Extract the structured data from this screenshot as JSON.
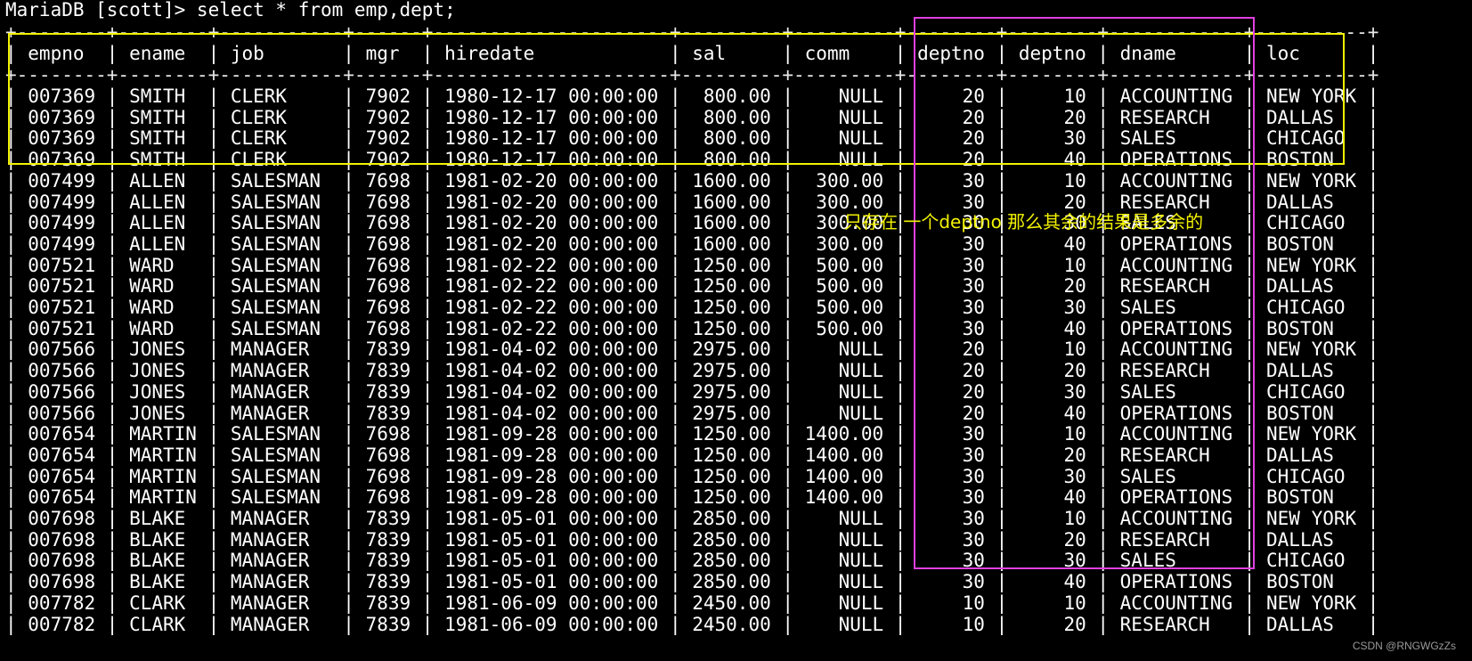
{
  "prompt": "MariaDB [scott]> select * from emp,dept;",
  "table": {
    "border_top": "+--------+--------+-----------+------+---------------------+---------+---------+--------+--------+------------+----------+",
    "header": "| empno  | ename  | job       | mgr  | hiredate            | sal     | comm    | deptno | deptno | dname      | loc      |",
    "separator": "+--------+--------+-----------+------+---------------------+---------+---------+--------+--------+------------+----------+",
    "rows": [
      "| 007369 | SMITH  | CLERK     | 7902 | 1980-12-17 00:00:00 |  800.00 |    NULL |     20 |     10 | ACCOUNTING | NEW YORK |",
      "| 007369 | SMITH  | CLERK     | 7902 | 1980-12-17 00:00:00 |  800.00 |    NULL |     20 |     20 | RESEARCH   | DALLAS   |",
      "| 007369 | SMITH  | CLERK     | 7902 | 1980-12-17 00:00:00 |  800.00 |    NULL |     20 |     30 | SALES      | CHICAGO  |",
      "| 007369 | SMITH  | CLERK     | 7902 | 1980-12-17 00:00:00 |  800.00 |    NULL |     20 |     40 | OPERATIONS | BOSTON   |",
      "| 007499 | ALLEN  | SALESMAN  | 7698 | 1981-02-20 00:00:00 | 1600.00 |  300.00 |     30 |     10 | ACCOUNTING | NEW YORK |",
      "| 007499 | ALLEN  | SALESMAN  | 7698 | 1981-02-20 00:00:00 | 1600.00 |  300.00 |     30 |     20 | RESEARCH   | DALLAS   |",
      "| 007499 | ALLEN  | SALESMAN  | 7698 | 1981-02-20 00:00:00 | 1600.00 |  300.00 |     30 |     30 | SALES      | CHICAGO  |",
      "| 007499 | ALLEN  | SALESMAN  | 7698 | 1981-02-20 00:00:00 | 1600.00 |  300.00 |     30 |     40 | OPERATIONS | BOSTON   |",
      "| 007521 | WARD   | SALESMAN  | 7698 | 1981-02-22 00:00:00 | 1250.00 |  500.00 |     30 |     10 | ACCOUNTING | NEW YORK |",
      "| 007521 | WARD   | SALESMAN  | 7698 | 1981-02-22 00:00:00 | 1250.00 |  500.00 |     30 |     20 | RESEARCH   | DALLAS   |",
      "| 007521 | WARD   | SALESMAN  | 7698 | 1981-02-22 00:00:00 | 1250.00 |  500.00 |     30 |     30 | SALES      | CHICAGO  |",
      "| 007521 | WARD   | SALESMAN  | 7698 | 1981-02-22 00:00:00 | 1250.00 |  500.00 |     30 |     40 | OPERATIONS | BOSTON   |",
      "| 007566 | JONES  | MANAGER   | 7839 | 1981-04-02 00:00:00 | 2975.00 |    NULL |     20 |     10 | ACCOUNTING | NEW YORK |",
      "| 007566 | JONES  | MANAGER   | 7839 | 1981-04-02 00:00:00 | 2975.00 |    NULL |     20 |     20 | RESEARCH   | DALLAS   |",
      "| 007566 | JONES  | MANAGER   | 7839 | 1981-04-02 00:00:00 | 2975.00 |    NULL |     20 |     30 | SALES      | CHICAGO  |",
      "| 007566 | JONES  | MANAGER   | 7839 | 1981-04-02 00:00:00 | 2975.00 |    NULL |     20 |     40 | OPERATIONS | BOSTON   |",
      "| 007654 | MARTIN | SALESMAN  | 7698 | 1981-09-28 00:00:00 | 1250.00 | 1400.00 |     30 |     10 | ACCOUNTING | NEW YORK |",
      "| 007654 | MARTIN | SALESMAN  | 7698 | 1981-09-28 00:00:00 | 1250.00 | 1400.00 |     30 |     20 | RESEARCH   | DALLAS   |",
      "| 007654 | MARTIN | SALESMAN  | 7698 | 1981-09-28 00:00:00 | 1250.00 | 1400.00 |     30 |     30 | SALES      | CHICAGO  |",
      "| 007654 | MARTIN | SALESMAN  | 7698 | 1981-09-28 00:00:00 | 1250.00 | 1400.00 |     30 |     40 | OPERATIONS | BOSTON   |",
      "| 007698 | BLAKE  | MANAGER   | 7839 | 1981-05-01 00:00:00 | 2850.00 |    NULL |     30 |     10 | ACCOUNTING | NEW YORK |",
      "| 007698 | BLAKE  | MANAGER   | 7839 | 1981-05-01 00:00:00 | 2850.00 |    NULL |     30 |     20 | RESEARCH   | DALLAS   |",
      "| 007698 | BLAKE  | MANAGER   | 7839 | 1981-05-01 00:00:00 | 2850.00 |    NULL |     30 |     30 | SALES      | CHICAGO  |",
      "| 007698 | BLAKE  | MANAGER   | 7839 | 1981-05-01 00:00:00 | 2850.00 |    NULL |     30 |     40 | OPERATIONS | BOSTON   |",
      "| 007782 | CLARK  | MANAGER   | 7839 | 1981-06-09 00:00:00 | 2450.00 |    NULL |     10 |     10 | ACCOUNTING | NEW YORK |",
      "| 007782 | CLARK  | MANAGER   | 7839 | 1981-06-09 00:00:00 | 2450.00 |    NULL |     10 |     20 | RESEARCH   | DALLAS   |"
    ]
  },
  "annotation": {
    "text": "只存在 一个deptno 那么其余的结果是多余的",
    "color": "#f2f200"
  },
  "highlight_colors": {
    "header_box": "#f2f200",
    "dept_box": "#e040e0"
  },
  "watermark": "CSDN @RNGWGzZs",
  "colors": {
    "background": "#000000",
    "text": "#ffffff"
  }
}
